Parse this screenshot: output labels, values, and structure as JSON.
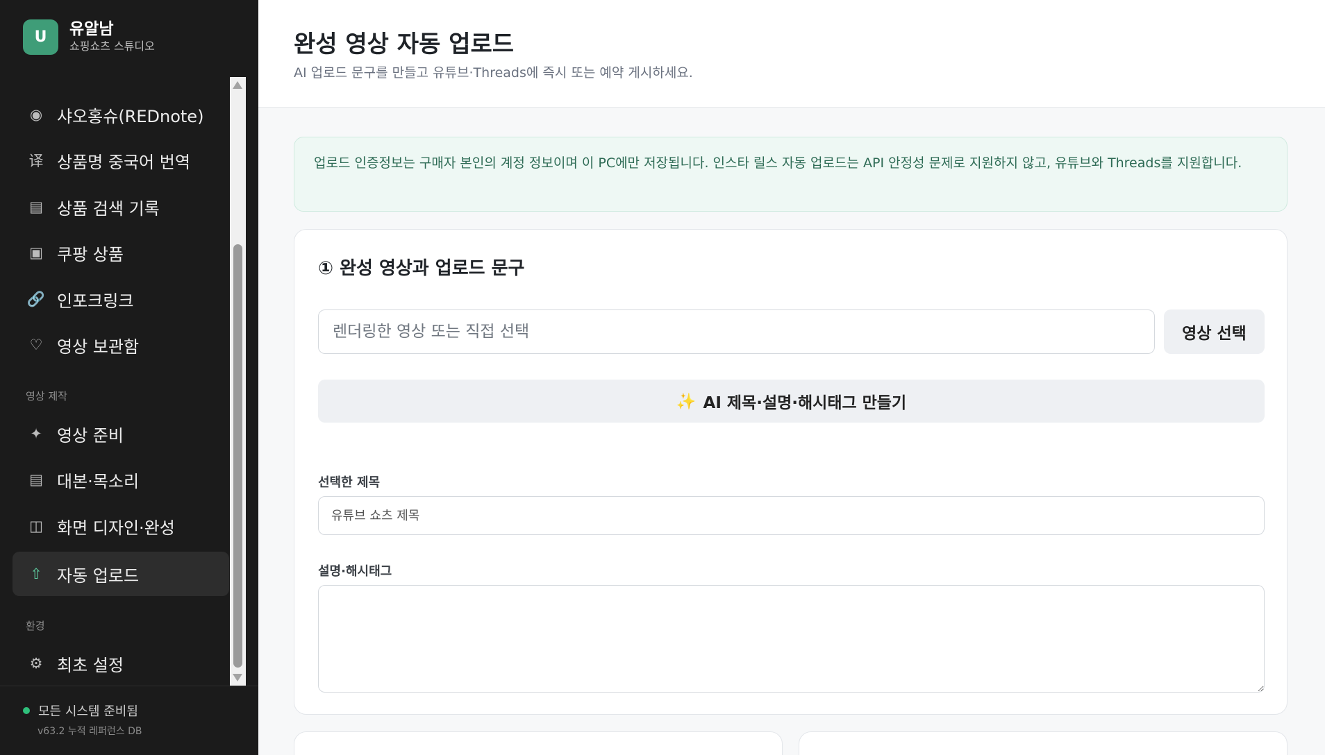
{
  "brand": {
    "logo_letter": "U",
    "name": "유알남",
    "subtitle": "쇼핑쇼츠 스튜디오"
  },
  "sidebar": {
    "items": [
      {
        "icon": "record-icon",
        "glyph": "◉",
        "label": "샤오홍슈(REDnote)"
      },
      {
        "icon": "translate-icon",
        "glyph": "译",
        "label": "상품명 중국어 번역"
      },
      {
        "icon": "list-icon",
        "glyph": "▤",
        "label": "상품 검색 기록"
      },
      {
        "icon": "box-icon",
        "glyph": "▣",
        "label": "쿠팡 상품"
      },
      {
        "icon": "link-icon",
        "glyph": "🔗",
        "label": "인포크링크"
      },
      {
        "icon": "heart-icon",
        "glyph": "♡",
        "label": "영상 보관함"
      }
    ],
    "section_production": "영상 제작",
    "production_items": [
      {
        "icon": "sparkle-icon",
        "glyph": "✦",
        "label": "영상 준비"
      },
      {
        "icon": "script-icon",
        "glyph": "▤",
        "label": "대본·목소리"
      },
      {
        "icon": "layout-icon",
        "glyph": "◫",
        "label": "화면 디자인·완성"
      },
      {
        "icon": "upload-icon",
        "glyph": "⇧",
        "label": "자동 업로드",
        "active": true
      }
    ],
    "section_env": "환경",
    "env_items": [
      {
        "icon": "gear-icon",
        "glyph": "⚙",
        "label": "최초 설정"
      }
    ],
    "status": "모든 시스템 준비됨",
    "version": "v63.2 누적 레퍼런스 DB"
  },
  "header": {
    "title": "완성 영상 자동 업로드",
    "subtitle": "AI 업로드 문구를 만들고 유튜브·Threads에 즉시 또는 예약 게시하세요."
  },
  "notice": "업로드 인증정보는 구매자 본인의 계정 정보이며 이 PC에만 저장됩니다. 인스타 릴스 자동 업로드는 API 안정성 문제로 지원하지 않고, 유튜브와 Threads를 지원합니다.",
  "card": {
    "title": "① 완성 영상과 업로드 문구",
    "file_placeholder": "렌더링한 영상 또는 직접 선택",
    "select_button": "영상 선택",
    "ai_button": "AI 제목·설명·해시태그 만들기",
    "ai_glyph": "✨",
    "title_label": "선택한 제목",
    "title_placeholder": "유튜브 쇼츠 제목",
    "desc_label": "설명·해시태그",
    "desc_value": ""
  },
  "colors": {
    "accent": "#3f9d78",
    "sidebar_bg": "#1b1b1b",
    "notice_bg": "#eef8f4",
    "status_dot": "#2fc07b"
  }
}
